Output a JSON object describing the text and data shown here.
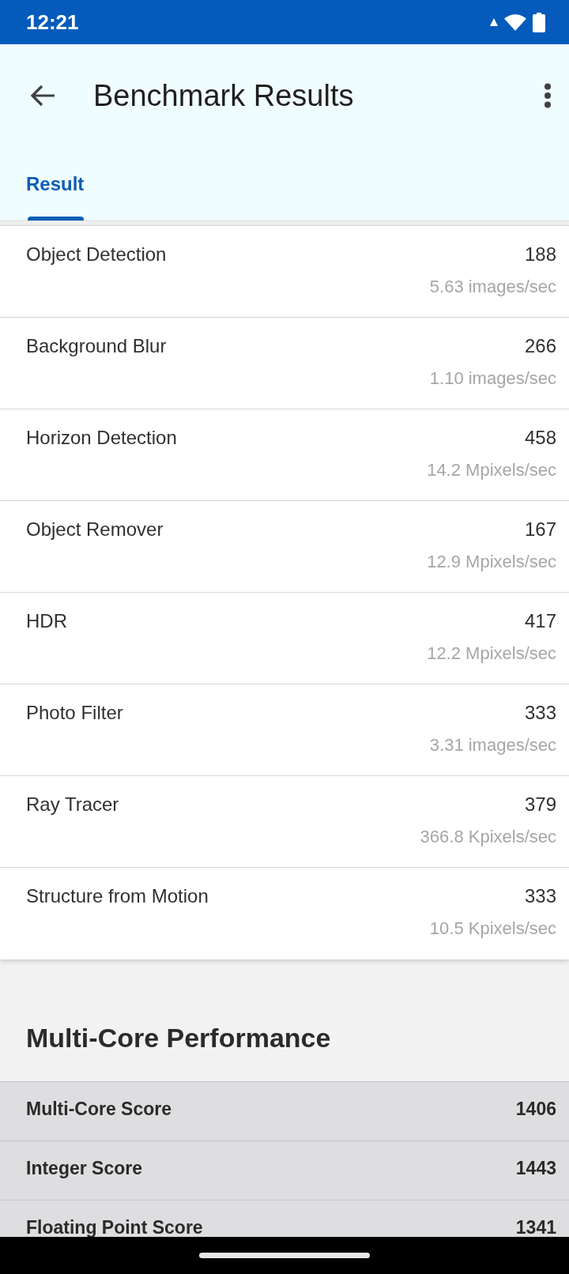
{
  "status_bar": {
    "time": "12:21"
  },
  "app_bar": {
    "title": "Benchmark Results"
  },
  "tabs": [
    {
      "label": "Result",
      "selected": true
    }
  ],
  "benchmarks": [
    {
      "name": "Object Detection",
      "score": "188",
      "rate": "5.63 images/sec"
    },
    {
      "name": "Background Blur",
      "score": "266",
      "rate": "1.10 images/sec"
    },
    {
      "name": "Horizon Detection",
      "score": "458",
      "rate": "14.2 Mpixels/sec"
    },
    {
      "name": "Object Remover",
      "score": "167",
      "rate": "12.9 Mpixels/sec"
    },
    {
      "name": "HDR",
      "score": "417",
      "rate": "12.2 Mpixels/sec"
    },
    {
      "name": "Photo Filter",
      "score": "333",
      "rate": "3.31 images/sec"
    },
    {
      "name": "Ray Tracer",
      "score": "379",
      "rate": "366.8 Kpixels/sec"
    },
    {
      "name": "Structure from Motion",
      "score": "333",
      "rate": "10.5 Kpixels/sec"
    }
  ],
  "multi_core": {
    "title": "Multi-Core Performance",
    "scores": [
      {
        "label": "Multi-Core Score",
        "value": "1406"
      },
      {
        "label": "Integer Score",
        "value": "1443"
      },
      {
        "label": "Floating Point Score",
        "value": "1341"
      }
    ]
  }
}
